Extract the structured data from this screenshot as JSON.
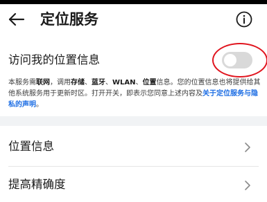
{
  "header": {
    "title": "定位服务",
    "back_icon": "arrow-left-icon",
    "info_icon": "info-circle-icon"
  },
  "access": {
    "label": "访问我的位置信息",
    "toggle_on": false,
    "description": {
      "t1": "本服务需",
      "b1": "联网",
      "t2": "，调用",
      "b2": "存储",
      "t3": "、",
      "b3": "蓝牙",
      "t4": "、",
      "b4": "WLAN",
      "t5": "、",
      "b5": "位置",
      "t6": "信息。您的位置信息也将提供给其他系统服务用于更新时区。打开开关，即表示您同意上述内容及",
      "link": "关于定位服务与隐私的声明",
      "t7": "。"
    }
  },
  "list": {
    "items": [
      {
        "label": "位置信息",
        "icon": "chevron-right-icon"
      },
      {
        "label": "提高精确度",
        "icon": "chevron-right-icon"
      }
    ]
  },
  "colors": {
    "link": "#1d6ee4",
    "toggle_off": "#d9d9d9",
    "annotation": "#e0141e",
    "section_gap": "#f1f3f5"
  }
}
